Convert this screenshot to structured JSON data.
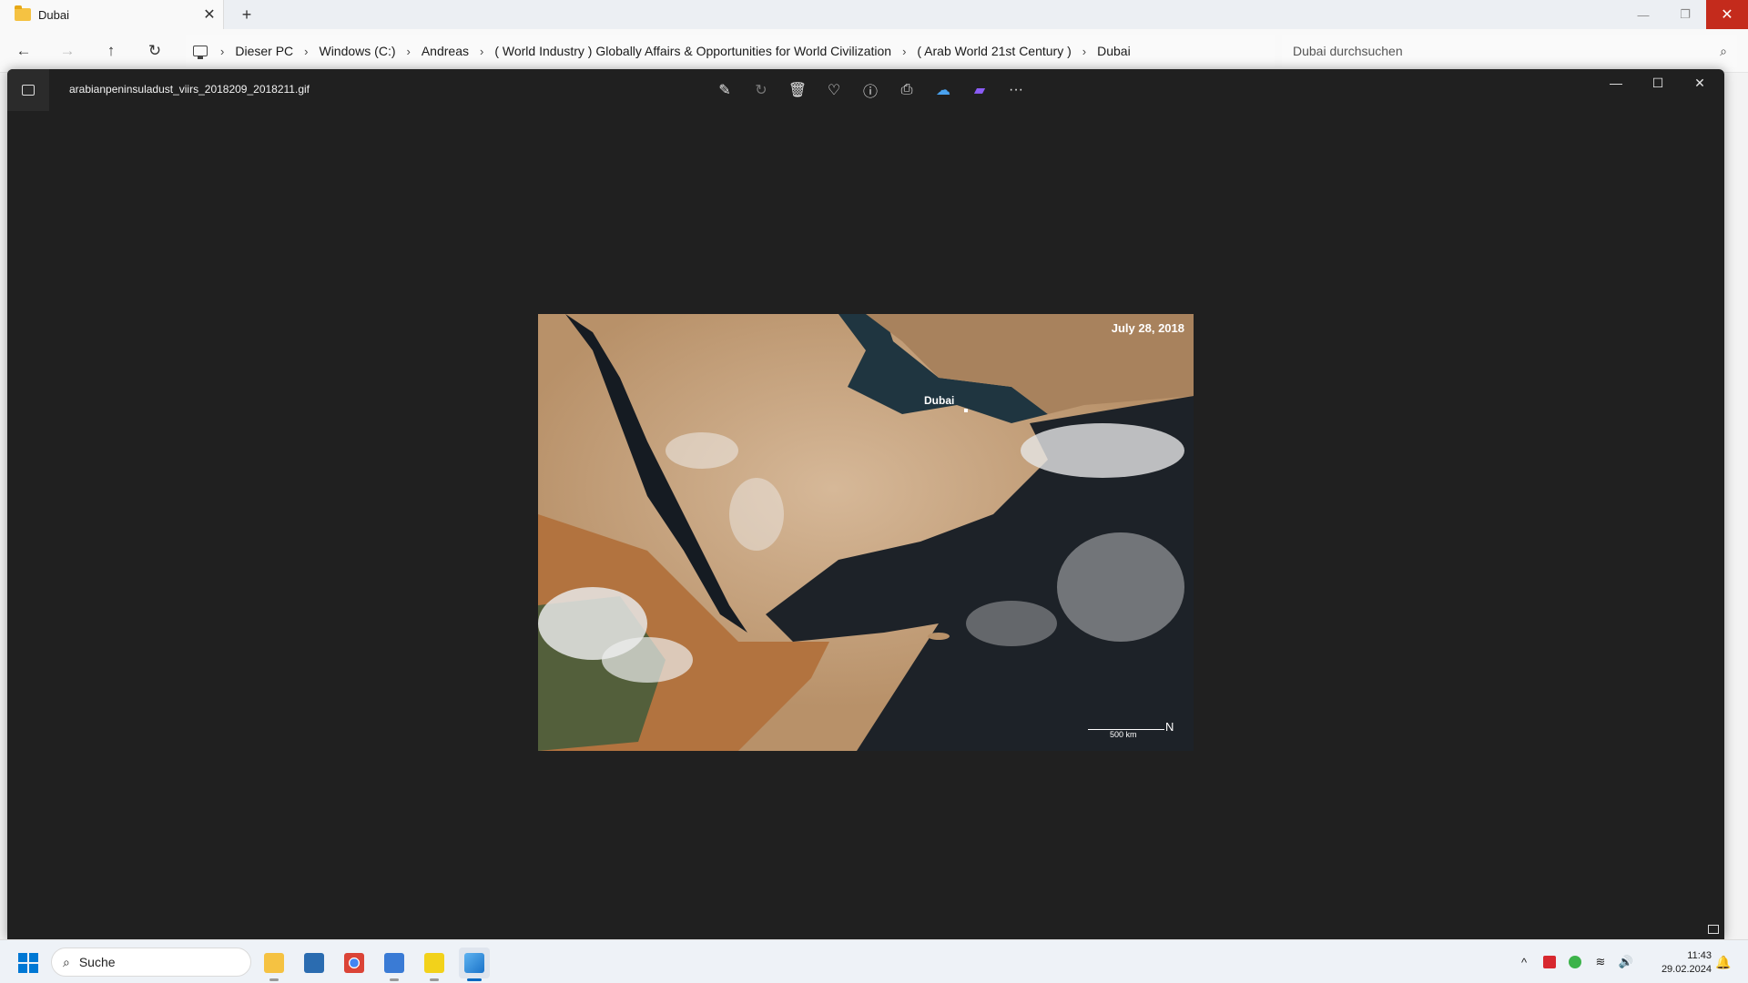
{
  "explorer": {
    "tab": {
      "title": "Dubai",
      "close_glyph": "✕"
    },
    "new_tab_glyph": "+",
    "window_controls": {
      "minimize": "—",
      "restore": "❐",
      "close": "✕"
    },
    "nav": {
      "back": "←",
      "forward": "→",
      "up": "↑",
      "refresh": "↻"
    },
    "breadcrumb": [
      "Dieser PC",
      "Windows (C:)",
      "Andreas",
      "( World Industry ) Globally Affairs & Opportunities for World Civilization",
      "( Arab World 21st Century )",
      "Dubai"
    ],
    "breadcrumb_separator": "›",
    "search": {
      "placeholder": "Dubai durchsuchen",
      "icon": "search-icon"
    }
  },
  "viewer": {
    "file_name": "arabianpeninsuladust_viirs_2018209_2018211.gif",
    "toolbar": [
      {
        "name": "edit-image-icon",
        "glyph": "✎"
      },
      {
        "name": "rotate-icon",
        "glyph": "↻"
      },
      {
        "name": "delete-icon",
        "glyph": "🗑"
      },
      {
        "name": "favorite-heart-icon",
        "glyph": "♡"
      },
      {
        "name": "info-icon",
        "glyph": "ⓘ"
      },
      {
        "name": "print-icon",
        "glyph": "⎙"
      },
      {
        "name": "onedrive-cloud-icon",
        "glyph": "☁"
      },
      {
        "name": "clipchamp-icon",
        "glyph": "▰"
      },
      {
        "name": "more-options-icon",
        "glyph": "···"
      }
    ],
    "window_controls": {
      "minimize": "—",
      "maximize": "☐",
      "close": "✕"
    },
    "image": {
      "date_label": "July 28, 2018",
      "city_label": "Dubai",
      "scale_label": "500 km",
      "north_glyph": "N"
    }
  },
  "taskbar": {
    "search_label": "Suche",
    "apps": [
      {
        "name": "file-explorer",
        "color": "#f5c242"
      },
      {
        "name": "microsoft-store",
        "color": "#2b6cb0"
      },
      {
        "name": "chrome",
        "color": "#db4437"
      },
      {
        "name": "notepad",
        "color": "#3a7bd5"
      },
      {
        "name": "player",
        "color": "#f2d21b"
      },
      {
        "name": "photos",
        "color": "#1a73c9"
      }
    ],
    "tray": {
      "chevron": "^",
      "wifi": "≋",
      "volume": "🔊"
    },
    "time": "11:43",
    "date": "29.02.2024"
  }
}
